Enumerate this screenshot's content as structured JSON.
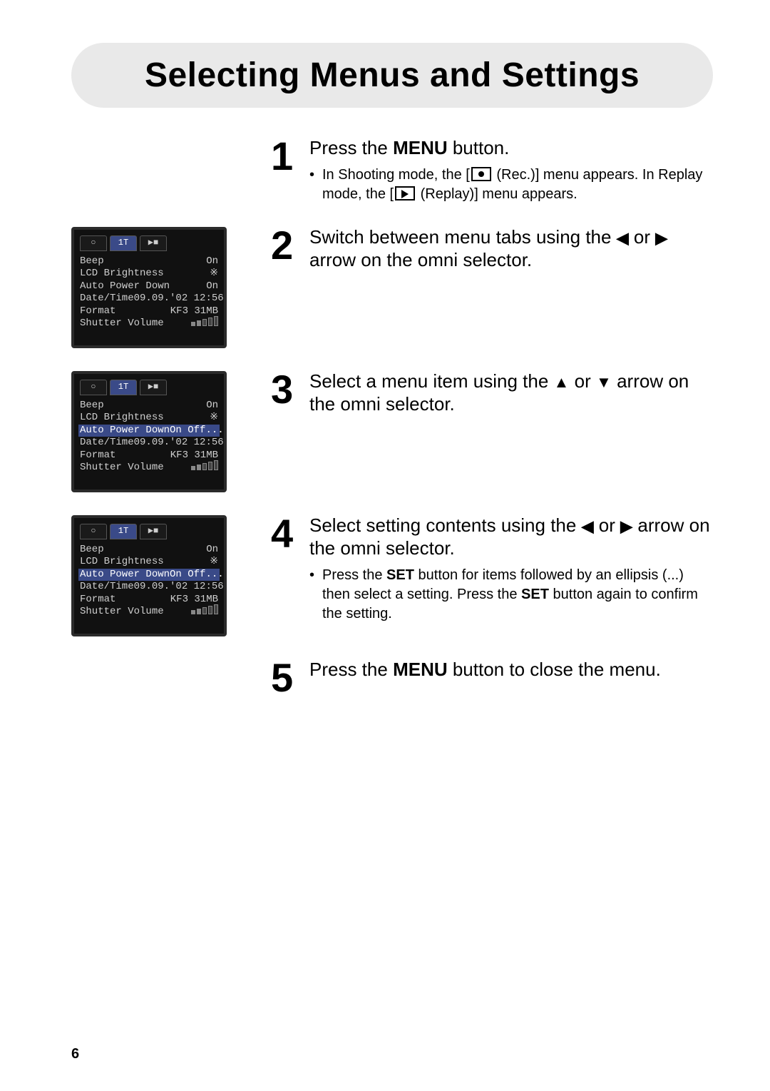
{
  "page_number": "6",
  "title": "Selecting Menus and Settings",
  "steps": [
    {
      "number": "1",
      "lead_pre": "Press the ",
      "lead_bold": "MENU",
      "lead_post": " button.",
      "bullets": [
        {
          "pre": "In Shooting mode, the [",
          "icon": "rec",
          "mid": " (Rec.)] menu appears. In Replay mode, the [",
          "icon2": "replay",
          "post": " (Replay)] menu appears."
        }
      ]
    },
    {
      "number": "2",
      "lead_full_a": "Switch between menu tabs using the ",
      "arrow_a": "left",
      "lead_full_b": " or ",
      "arrow_b": "right",
      "lead_full_c": " arrow on the omni selector."
    },
    {
      "number": "3",
      "lead_full_a": "Select a menu item using the ",
      "arrow_a": "up",
      "lead_full_b": " or ",
      "arrow_b": "down",
      "lead_full_c": " arrow on the omni selector."
    },
    {
      "number": "4",
      "lead_full_a": "Select setting contents using the ",
      "arrow_a": "left",
      "lead_full_b": " or ",
      "arrow_b": "right",
      "lead_full_c": " arrow on the omni selector.",
      "bullets": [
        {
          "pre": "Press the ",
          "bold1": "SET",
          "mid": " button for items followed by an ellipsis (...) then select a setting. Press the ",
          "bold2": "SET",
          "post": " button again to confirm the setting."
        }
      ]
    },
    {
      "number": "5",
      "lead_pre": "Press the ",
      "lead_bold": "MENU",
      "lead_post": " button to close the menu."
    }
  ],
  "lcd": {
    "tabs": [
      {
        "icon": "○",
        "sel": false
      },
      {
        "icon": "1T",
        "sel": true
      },
      {
        "icon": "▶■",
        "sel": false
      }
    ],
    "rows": [
      {
        "k": "Beep",
        "v": "On"
      },
      {
        "k": "LCD Brightness",
        "v": "※"
      },
      {
        "k": "Auto Power Down",
        "v": "On"
      },
      {
        "k": "Date/Time",
        "v": "09.09.'02 12:56"
      },
      {
        "k": "Format",
        "v": "KF3  31MB"
      },
      {
        "k": "Shutter Volume",
        "v": "▂▃▅▆▇"
      }
    ],
    "hi_row_idx_s2": -1,
    "hi_row_idx_s3": 2,
    "hi_row_idx_s4": 2,
    "hi_value_s3": "On  Off...",
    "hi_value_s4": "On  Off..."
  }
}
